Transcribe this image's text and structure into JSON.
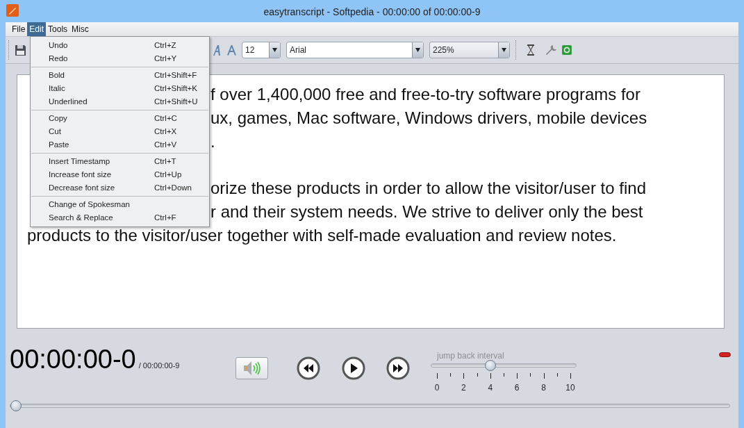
{
  "window": {
    "title": "easytranscript - Softpedia - 00:00:00 of 00:00:00-9"
  },
  "menu_bar": [
    {
      "label": "File",
      "selected": false
    },
    {
      "label": "Edit",
      "selected": true
    },
    {
      "label": "Tools",
      "selected": false
    },
    {
      "label": "Misc",
      "selected": false
    }
  ],
  "open_menu": {
    "groups": [
      [
        {
          "label": "Undo",
          "shortcut": "Ctrl+Z"
        },
        {
          "label": "Redo",
          "shortcut": "Ctrl+Y"
        }
      ],
      [
        {
          "label": "Bold",
          "shortcut": "Ctrl+Shift+F"
        },
        {
          "label": "Italic",
          "shortcut": "Ctrl+Shift+K"
        },
        {
          "label": "Underlined",
          "shortcut": "Ctrl+Shift+U"
        }
      ],
      [
        {
          "label": "Copy",
          "shortcut": "Ctrl+C"
        },
        {
          "label": "Cut",
          "shortcut": "Ctrl+X"
        },
        {
          "label": "Paste",
          "shortcut": "Ctrl+V"
        }
      ],
      [
        {
          "label": "Insert Timestamp",
          "shortcut": "Ctrl+T"
        },
        {
          "label": "Increase font size",
          "shortcut": "Ctrl+Up"
        },
        {
          "label": "Decrease font size",
          "shortcut": "Ctrl+Down"
        }
      ],
      [
        {
          "label": "Change of Spokesman"
        },
        {
          "label": "Search & Replace",
          "shortcut": "Ctrl+F"
        }
      ]
    ]
  },
  "toolbar": {
    "font_size": "12",
    "font": "Arial",
    "zoom": "225%"
  },
  "document": {
    "paragraphs": [
      [
        {
          "right": "f over 1,400,000 free and free-to-try software programs for"
        },
        {
          "right": "ux, games, Mac software, Windows drivers, mobile devices"
        },
        {
          "right": "."
        }
      ],
      [
        {
          "right": "orize these products in order to allow the visitor/user to find"
        },
        {
          "right": "r and their system needs. We strive to deliver only the best"
        },
        {
          "left": "products to the visitor/user together with self-made evaluation and review notes."
        }
      ]
    ]
  },
  "player": {
    "time": "00:00:00-0",
    "total": "/ 00:00:00-9",
    "jump_back": {
      "label": "jump back interval",
      "level": 0.4,
      "ticks": [
        "0",
        "2",
        "4",
        "6",
        "8",
        "10"
      ]
    },
    "position": {
      "level": 0
    }
  }
}
